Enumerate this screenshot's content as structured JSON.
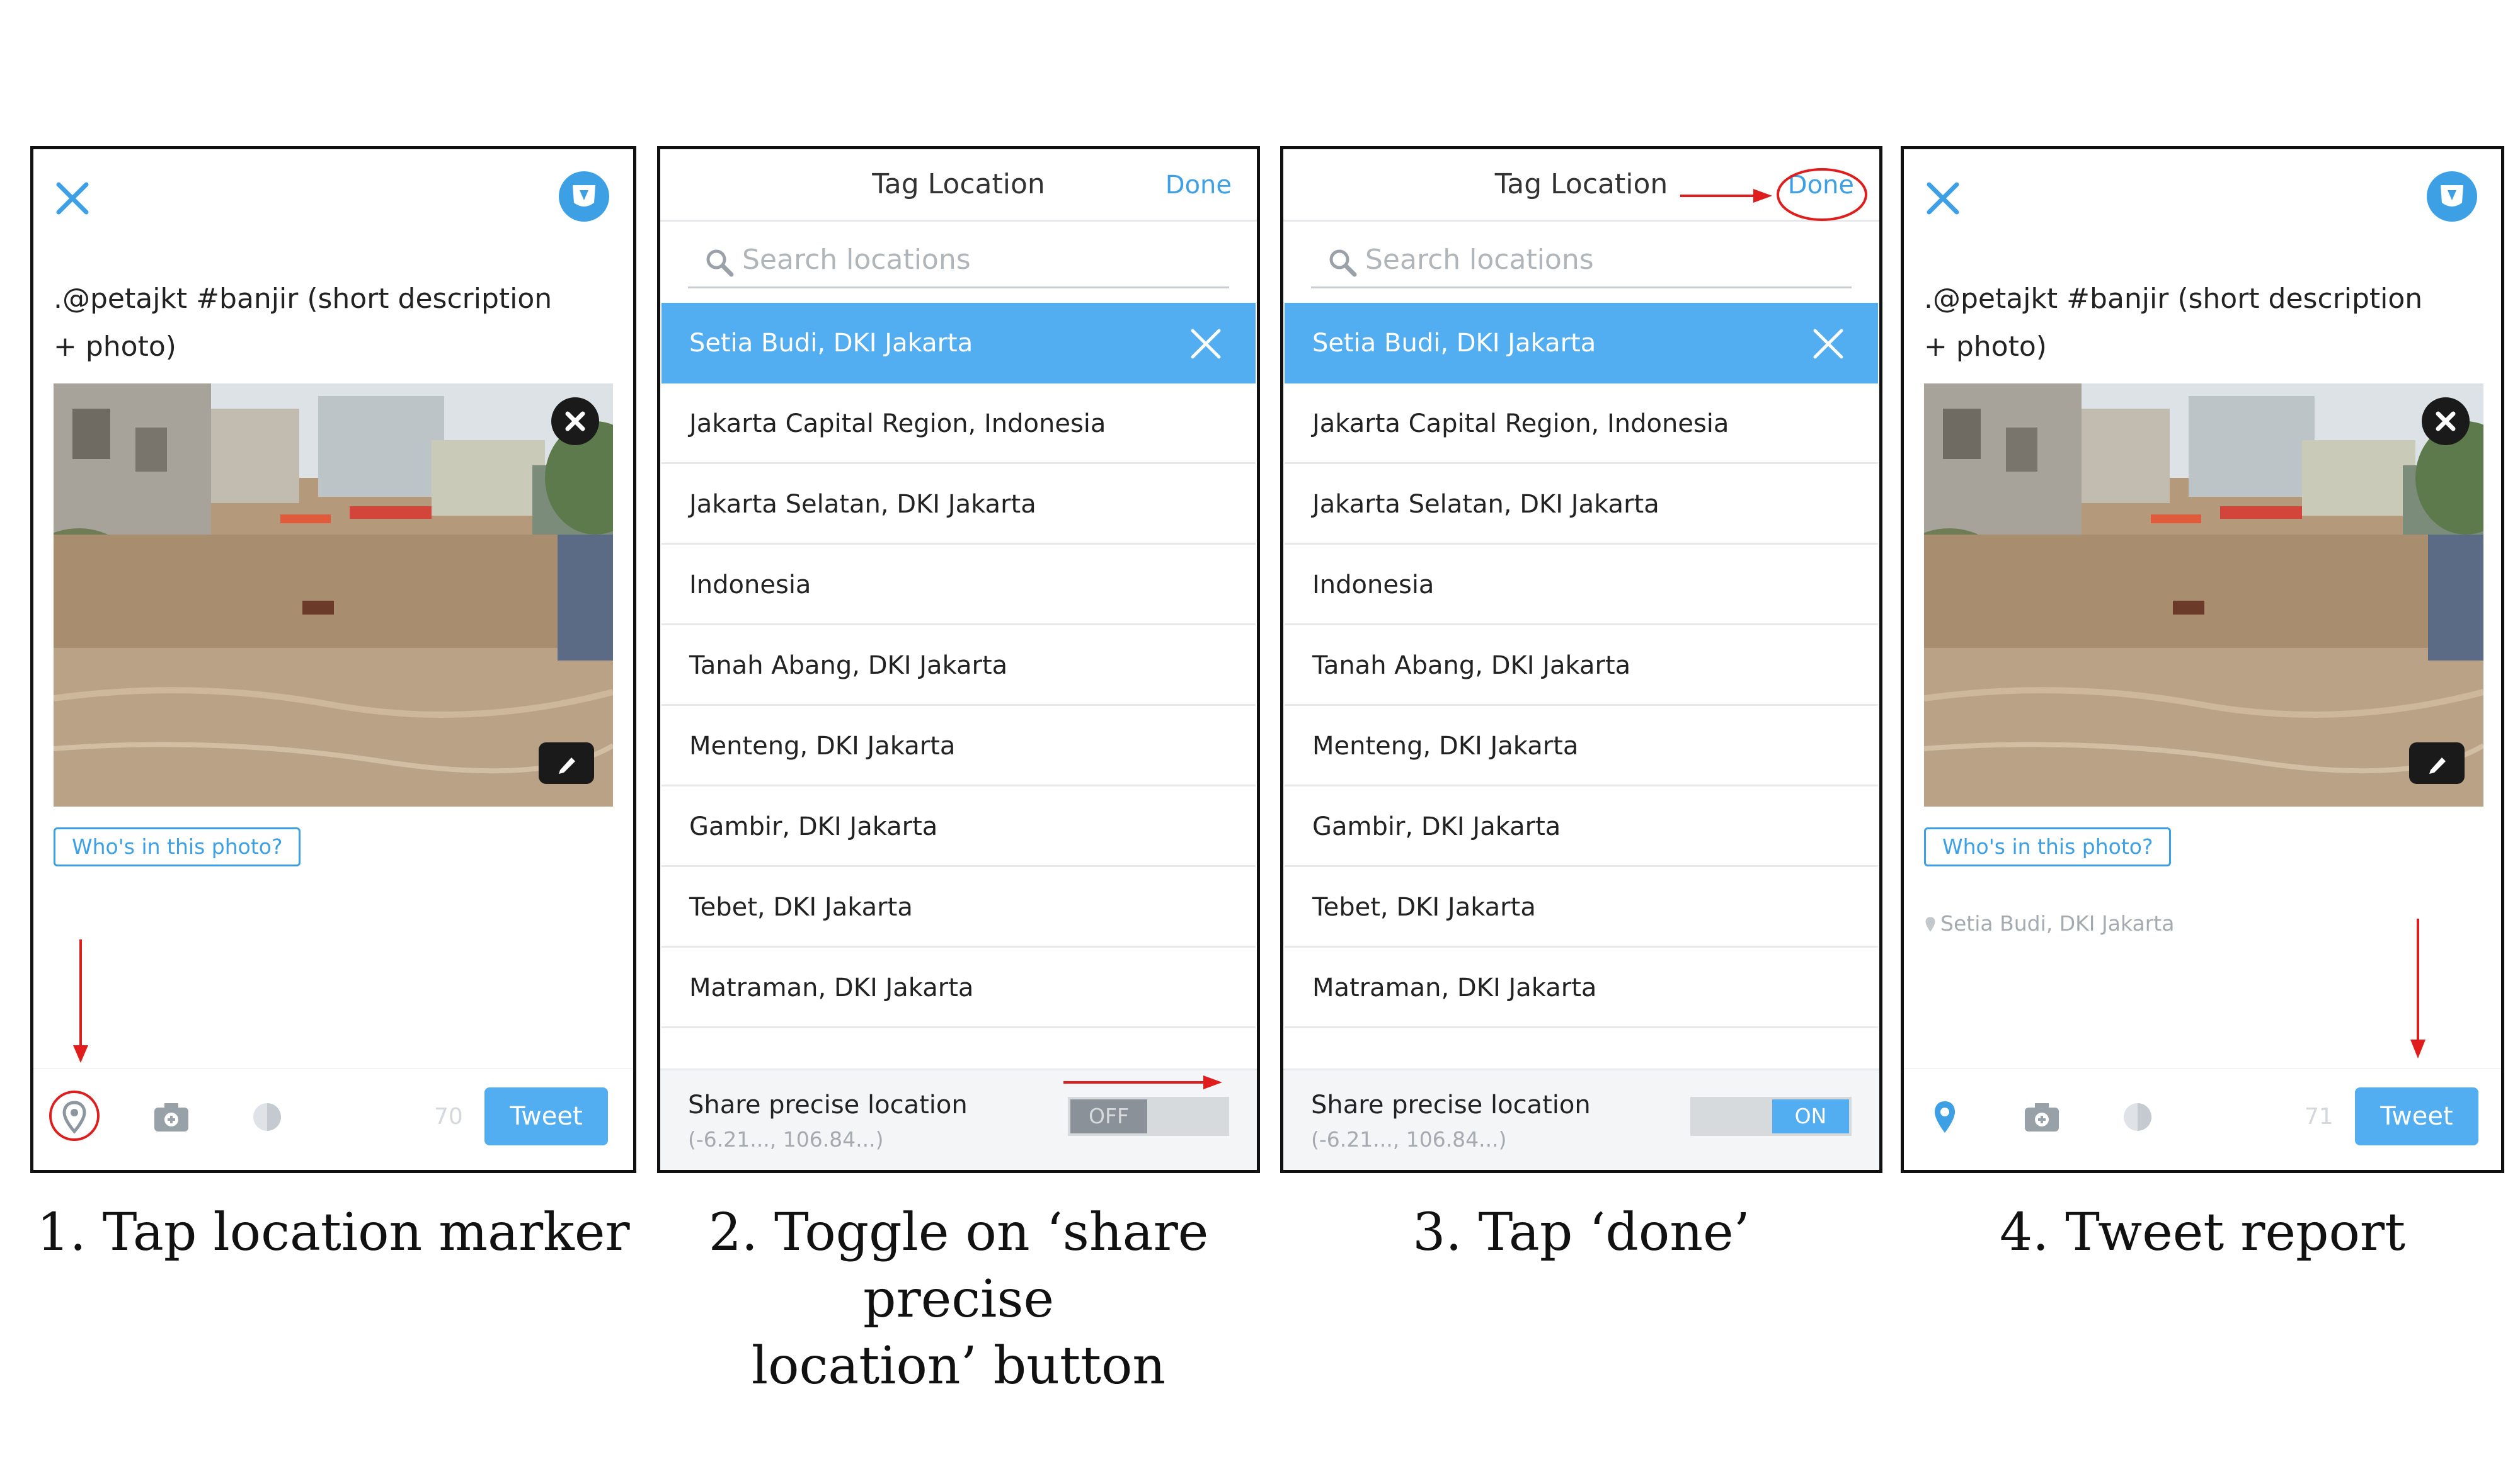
{
  "colors": {
    "accent": "#3da0e4",
    "selected_row": "#52aef0",
    "annotation": "#e01d1d"
  },
  "step1": {
    "compose_text": ".@petajkt #banjir (short description + photo)",
    "whos_in_photo": "Who's in this photo?",
    "char_count": "70",
    "tweet_label": "Tweet",
    "icons": [
      "close-icon",
      "brand-shield-icon",
      "photo-close-icon",
      "edit-pencil-icon",
      "location-marker-icon",
      "camera-icon",
      "gif-icon"
    ],
    "caption": "1. Tap location marker"
  },
  "step2": {
    "title": "Tag Location",
    "done_label": "Done",
    "search_placeholder": "Search locations",
    "locations": [
      "Setia Budi, DKI Jakarta",
      "Jakarta Capital Region, Indonesia",
      "Jakarta Selatan, DKI Jakarta",
      "Indonesia",
      "Tanah Abang, DKI Jakarta",
      "Menteng, DKI Jakarta",
      "Gambir, DKI Jakarta",
      "Tebet, DKI Jakarta",
      "Matraman, DKI Jakarta"
    ],
    "share_label": "Share precise location",
    "share_coords": "(-6.21..., 106.84...)",
    "toggle_state": "OFF",
    "caption": "2. Toggle on ‘share precise\nlocation’ button"
  },
  "step3": {
    "title": "Tag Location",
    "done_label": "Done",
    "search_placeholder": "Search locations",
    "locations": [
      "Setia Budi, DKI Jakarta",
      "Jakarta Capital Region, Indonesia",
      "Jakarta Selatan, DKI Jakarta",
      "Indonesia",
      "Tanah Abang, DKI Jakarta",
      "Menteng, DKI Jakarta",
      "Gambir, DKI Jakarta",
      "Tebet, DKI Jakarta",
      "Matraman, DKI Jakarta"
    ],
    "share_label": "Share precise location",
    "share_coords": "(-6.21..., 106.84...)",
    "toggle_state": "ON",
    "caption": "3. Tap ‘done’"
  },
  "step4": {
    "compose_text": ".@petajkt #banjir (short description + photo)",
    "whos_in_photo": "Who's in this photo?",
    "tagged_location": "Setia Budi, DKI Jakarta",
    "char_count": "71",
    "tweet_label": "Tweet",
    "caption": "4. Tweet report"
  }
}
